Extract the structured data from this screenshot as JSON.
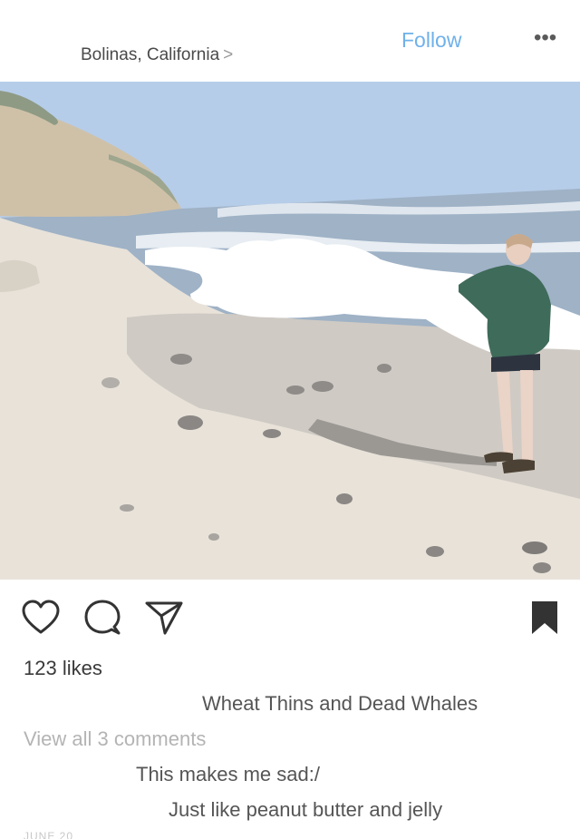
{
  "header": {
    "location": "Bolinas, California",
    "location_chevron": ">",
    "follow_label": "Follow",
    "more_label": "•••"
  },
  "photo": {
    "subject": "beach-photo",
    "colors": {
      "sky": "#a9c6e6",
      "sea": "#8fa6bd",
      "sand": "#e6dfd5",
      "cliff": "#cdbfa6",
      "jacket": "#3e6a58"
    }
  },
  "actions": {
    "like_icon": "heart-icon",
    "comment_icon": "comment-icon",
    "share_icon": "send-icon",
    "save_icon": "bookmark-icon"
  },
  "post": {
    "likes": "123 likes",
    "caption": "Wheat Thins and Dead Whales",
    "view_all_comments": "View all 3 comments",
    "comments": [
      "This makes me sad:/",
      "Just like peanut butter and jelly"
    ],
    "date": "JUNE 20"
  }
}
